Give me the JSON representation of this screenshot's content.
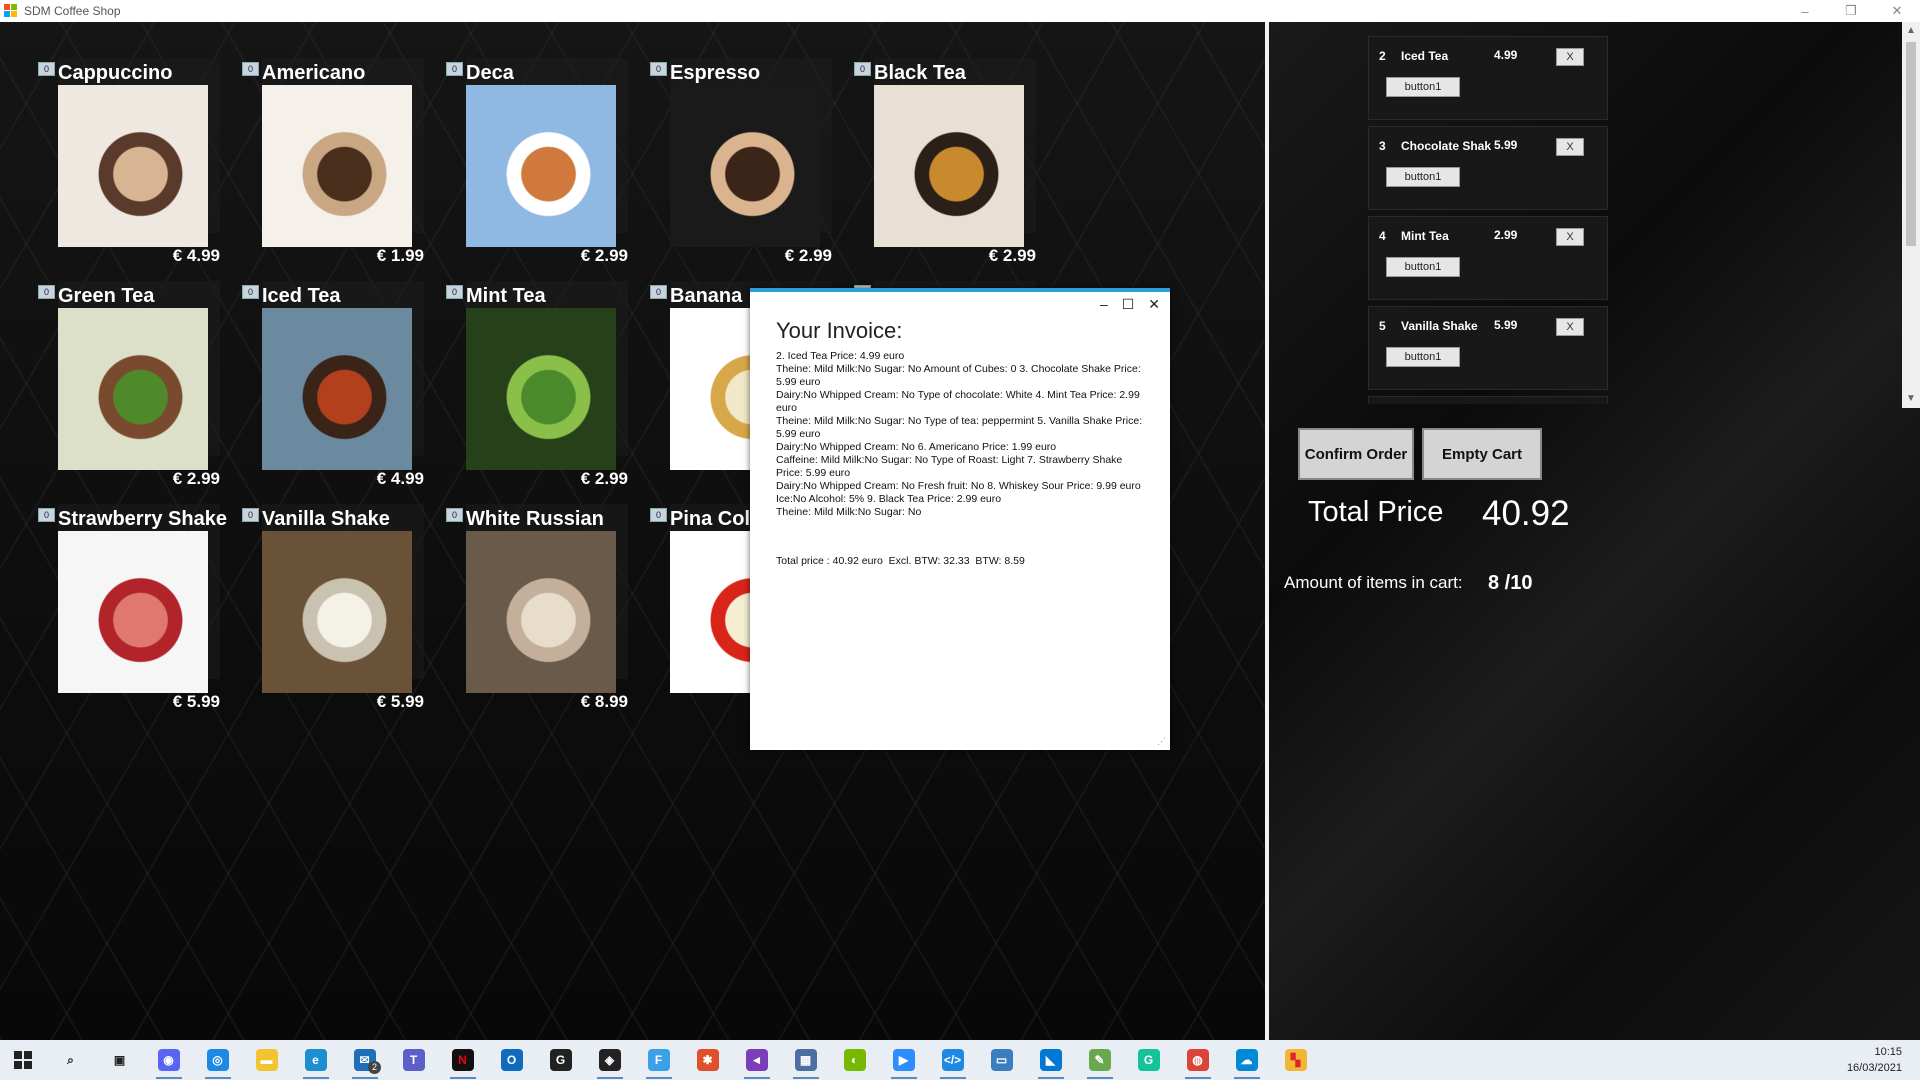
{
  "window": {
    "title": "SDM Coffee Shop",
    "controls": [
      "–",
      "❐",
      "✕"
    ]
  },
  "menu": {
    "items": [
      {
        "qty": "0",
        "name": "Cappuccino",
        "price": "€ 4.99",
        "colors": [
          "#d8b592",
          "#5a3a2a",
          "#efe8e0"
        ]
      },
      {
        "qty": "0",
        "name": "Americano",
        "price": "€ 1.99",
        "colors": [
          "#4a2e1c",
          "#c9a783",
          "#f5f0ea"
        ]
      },
      {
        "qty": "0",
        "name": "Deca",
        "price": "€ 2.99",
        "colors": [
          "#cf7a3c",
          "#ffffff",
          "#8fb8e3"
        ]
      },
      {
        "qty": "0",
        "name": "Espresso",
        "price": "€ 2.99",
        "colors": [
          "#3b2418",
          "#d9b48e",
          "#1a1a1a"
        ]
      },
      {
        "qty": "0",
        "name": "Black Tea",
        "price": "€ 2.99",
        "colors": [
          "#c98a2e",
          "#2a2018",
          "#e8e0d4"
        ]
      },
      {
        "qty": "0",
        "name": "Green Tea",
        "price": "€ 2.99",
        "colors": [
          "#4f8a2a",
          "#7a4a2e",
          "#dde0c8"
        ]
      },
      {
        "qty": "0",
        "name": "Iced Tea",
        "price": "€ 4.99",
        "colors": [
          "#b2401c",
          "#3a2418",
          "#6b8aa0"
        ]
      },
      {
        "qty": "0",
        "name": "Mint Tea",
        "price": "€ 2.99",
        "colors": [
          "#4a8a2a",
          "#8abf4a",
          "#26401a"
        ]
      },
      {
        "qty": "0",
        "name": "Banana",
        "price": "",
        "colors": [
          "#f2e7c8",
          "#d6a84a",
          "#ffffff"
        ]
      },
      {
        "qty": "0",
        "name": "",
        "price": "",
        "colors": [
          "#f2f2f2",
          "#f2f2f2",
          "#f2f2f2"
        ]
      },
      {
        "qty": "0",
        "name": "Strawberry Shake",
        "price": "€ 5.99",
        "colors": [
          "#e07870",
          "#b0242a",
          "#f6f6f6"
        ]
      },
      {
        "qty": "0",
        "name": "Vanilla Shake",
        "price": "€ 5.99",
        "colors": [
          "#f4f1e6",
          "#c9c2b0",
          "#6a5238"
        ]
      },
      {
        "qty": "0",
        "name": "White Russian",
        "price": "€ 8.99",
        "colors": [
          "#e8dccb",
          "#c4b09a",
          "#6a5a4a"
        ]
      },
      {
        "qty": "0",
        "name": "Pina Col",
        "price": "",
        "colors": [
          "#f4eed2",
          "#d9241a",
          "#ffffff"
        ]
      }
    ]
  },
  "cart": {
    "items": [
      {
        "num": "2",
        "name": "Iced Tea",
        "price": "4.99",
        "remove": "X",
        "button": "button1"
      },
      {
        "num": "3",
        "name": "Chocolate Shak",
        "price": "5.99",
        "remove": "X",
        "button": "button1"
      },
      {
        "num": "4",
        "name": "Mint Tea",
        "price": "2.99",
        "remove": "X",
        "button": "button1"
      },
      {
        "num": "5",
        "name": "Vanilla Shake",
        "price": "5.99",
        "remove": "X",
        "button": "button1"
      }
    ],
    "confirm_label": "Confirm Order",
    "empty_label": "Empty Cart",
    "total_label": "Total Price",
    "total_value": "40.92",
    "amount_label": "Amount of items in cart:",
    "amount_value": "8  /10"
  },
  "invoice": {
    "title": "Your Invoice:",
    "body": "2. Iced Tea Price: 4.99 euro\nTheine: Mild Milk:No Sugar: No Amount of Cubes: 0 3. Chocolate Shake Price: 5.99 euro\nDairy:No Whipped Cream: No Type of chocolate: White 4. Mint Tea Price: 2.99 euro\nTheine: Mild Milk:No Sugar: No Type of tea: peppermint 5. Vanilla Shake Price: 5.99 euro\nDairy:No Whipped Cream: No 6. Americano Price: 1.99 euro\nCaffeine: Mild Milk:No Sugar: No Type of Roast: Light 7. Strawberry Shake Price: 5.99 euro\nDairy:No Whipped Cream: No Fresh fruit: No 8. Whiskey Sour Price: 9.99 euro\nIce:No Alcohol: 5% 9. Black Tea Price: 2.99 euro\nTheine: Mild Milk:No Sugar: No",
    "totals": "Total price : 40.92 euro  Excl. BTW: 32.33  BTW: 8.59",
    "controls": [
      "–",
      "☐",
      "✕"
    ],
    "grip": "⋰"
  },
  "taskbar": {
    "icons": [
      {
        "name": "search-icon",
        "glyph": "⌕",
        "color": "#e8eef4",
        "fg": "#222"
      },
      {
        "name": "task-view-icon",
        "glyph": "▣",
        "color": "#e8eef4",
        "fg": "#222"
      },
      {
        "name": "discord-icon",
        "glyph": "◉",
        "color": "#5865f2",
        "fg": "#fff"
      },
      {
        "name": "app-icon",
        "glyph": "◎",
        "color": "#1e88e5",
        "fg": "#fff"
      },
      {
        "name": "file-explorer-icon",
        "glyph": "▬",
        "color": "#f4c430",
        "fg": "#fff"
      },
      {
        "name": "edge-icon",
        "glyph": "e",
        "color": "#1b8fd0",
        "fg": "#fff"
      },
      {
        "name": "mail-icon",
        "glyph": "✉",
        "color": "#1e6fb8",
        "fg": "#fff"
      },
      {
        "name": "teams-icon",
        "glyph": "T",
        "color": "#5b5fc7",
        "fg": "#fff"
      },
      {
        "name": "netflix-icon",
        "glyph": "N",
        "color": "#111",
        "fg": "#e50914"
      },
      {
        "name": "outlook-icon",
        "glyph": "O",
        "color": "#0f6cbd",
        "fg": "#fff"
      },
      {
        "name": "github-icon",
        "glyph": "G",
        "color": "#222",
        "fg": "#fff"
      },
      {
        "name": "dev-icon",
        "glyph": "◈",
        "color": "#222",
        "fg": "#fff"
      },
      {
        "name": "f-app-icon",
        "glyph": "F",
        "color": "#3aa0e8",
        "fg": "#fff"
      },
      {
        "name": "git-icon",
        "glyph": "✱",
        "color": "#e0502a",
        "fg": "#fff"
      },
      {
        "name": "visual-studio-icon",
        "glyph": "◄",
        "color": "#7a3fb8",
        "fg": "#fff"
      },
      {
        "name": "network-icon",
        "glyph": "▦",
        "color": "#4a6fa0",
        "fg": "#fff"
      },
      {
        "name": "nvidia-icon",
        "glyph": "◐",
        "color": "#76b900",
        "fg": "#fff"
      },
      {
        "name": "zoom-icon",
        "glyph": "▶",
        "color": "#2d8cff",
        "fg": "#fff"
      },
      {
        "name": "code-icon",
        "glyph": "</>",
        "color": "#1e88e5",
        "fg": "#fff"
      },
      {
        "name": "window-icon",
        "glyph": "▭",
        "color": "#3b7ec0",
        "fg": "#fff"
      },
      {
        "name": "vscode-icon",
        "glyph": "◣",
        "color": "#0078d4",
        "fg": "#fff"
      },
      {
        "name": "notepad-icon",
        "glyph": "✎",
        "color": "#6aa84f",
        "fg": "#fff"
      },
      {
        "name": "grammarly-icon",
        "glyph": "G",
        "color": "#15c39a",
        "fg": "#fff"
      },
      {
        "name": "chrome-icon",
        "glyph": "◍",
        "color": "#db4437",
        "fg": "#fff"
      },
      {
        "name": "azure-icon",
        "glyph": "☁",
        "color": "#0089d6",
        "fg": "#fff"
      },
      {
        "name": "coffee-shop-app-icon",
        "glyph": "▚",
        "color": "#f2b632",
        "fg": "#d23"
      }
    ],
    "mail_badge": "2",
    "time": "10:15",
    "date": "16/03/2021"
  }
}
